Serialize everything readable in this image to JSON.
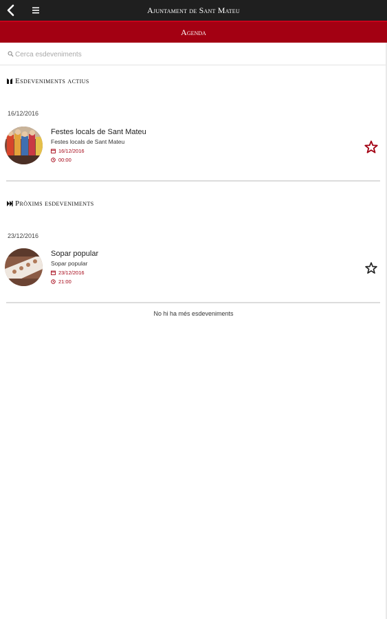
{
  "header": {
    "title": "Ajuntament de Sant Mateu",
    "back_icon": "back-arrow-icon",
    "menu_icon": "hamburger-menu-icon"
  },
  "subheader": {
    "title": "Agenda"
  },
  "search": {
    "placeholder": "Cerca esdeveniments",
    "value": ""
  },
  "sections": {
    "active": {
      "title": "Esdeveniments actius",
      "icon": "pause-icon",
      "date": "16/12/2016",
      "event": {
        "name": "Festes locals de Sant Mateu",
        "subtitle": "Festes locals de Sant Mateu",
        "date": "16/12/2016",
        "time": "00:00",
        "favorite_color": "#a30012"
      }
    },
    "upcoming": {
      "title": "Pròxims esdeveniments",
      "icon": "skip-forward-icon",
      "date": "23/12/2016",
      "event": {
        "name": "Sopar popular",
        "subtitle": "Sopar popular",
        "date": "23/12/2016",
        "time": "21:00",
        "favorite_color": "#222222"
      }
    }
  },
  "footer": {
    "message": "No hi ha més esdeveniments"
  },
  "colors": {
    "header_bg": "#1f1f1f",
    "accent": "#a30012"
  }
}
